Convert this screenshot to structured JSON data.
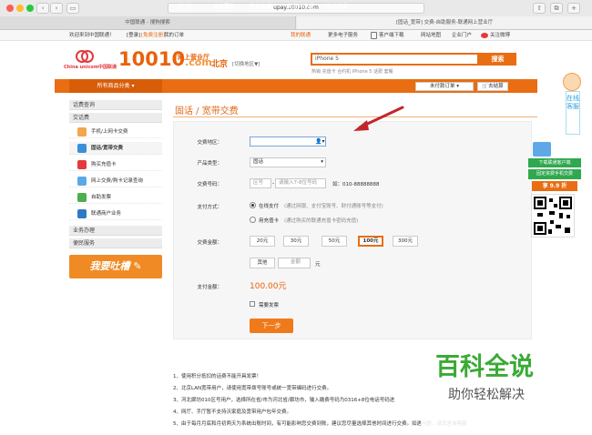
{
  "browser": {
    "url": "upay.10010.com",
    "tabs": [
      "中国联通 - 搜狗搜索",
      "[固话_宽带] 交费-自助服务-联通网上营业厅"
    ]
  },
  "topbar": {
    "welcome": "欢迎来到中国联通！",
    "login": "[登录]",
    "register": "[免费注册]",
    "my_orders": "我的订单",
    "my_unicom": "我的联通",
    "more_ebiz": "更多电子服务",
    "client_download": "客户端下载",
    "site_map": "网站地图",
    "enterprise": "企业门户",
    "weibo": "关注微博"
  },
  "header": {
    "logo_text": "China unicom中国联通",
    "brand": "10010",
    "brand_com": ".com",
    "brand_sub": "网上营业厅",
    "city": "北京",
    "city_switch": "[切换地区▼]",
    "search_value": "iPhone 5",
    "search_button": "搜索",
    "hot_words": "热销 充值卡  合约机  iPhone 5 话费  套餐"
  },
  "nav": {
    "categories": "所有商品分类",
    "items": [
      "首  页",
      "自助服务",
      "积分商城",
      "老用户专区",
      "中小企业"
    ],
    "unpaid_orders": "未付款订单",
    "cart": "去结算"
  },
  "sidebar": {
    "sections": [
      {
        "title": "话费查询",
        "items": []
      },
      {
        "title": "交话费",
        "items": [
          "手机/上网卡交费",
          "固话/宽带交费",
          "购买充值卡",
          "网上交费/购卡记录查询",
          "自助发票",
          "联通商户业务"
        ]
      },
      {
        "title": "业务办理",
        "items": []
      },
      {
        "title": "便民服务",
        "items": []
      }
    ],
    "complaint_banner": "我要吐槽"
  },
  "main": {
    "title": "固话 / 宽带交费",
    "fields": {
      "area_label": "交费地区：",
      "product_label": "产品类型：",
      "product_value": "固话",
      "number_label": "交费号码：",
      "area_code_placeholder": "区号",
      "dash": "-",
      "number_placeholder": "请输入7-8位号码",
      "example": "如：010-88888888",
      "method_label": "支付方式：",
      "method_online": "在线支付",
      "method_online_desc": "(通过网银、支付宝账号、财付通账号等支付)",
      "method_card": "用充值卡",
      "method_card_desc": "(通过购买的联通充值卡密码充值)",
      "amount_label": "交费金额：",
      "amounts": [
        "20元",
        "30元",
        "50元",
        "100元",
        "300元"
      ],
      "amount_selected": "100元",
      "other": "其他",
      "amount_placeholder": "金额",
      "unit": "元",
      "pay_label": "支付金额：",
      "pay_value": "100.00元",
      "invoice": "需要发票",
      "next_button": "下一步"
    },
    "notes": [
      "1、使用积分抵扣的话费不能开具发票！",
      "2、北京LAN宽带用户，请使用宽带拨号账号或统一宽带编码进行交费。",
      "3、河北廊坊010区号用户，选择所在省/市为河北省/廊坊市，输入缴费号码为0316+8位电话号码进",
      "4、网厅、手厅暂不支持沃家庭及宽带用户包年交费。",
      "5、由于每月月底和月初两天为系统出账时间，有可能影响您交费到账，建议您尽量选择其他时间进行交费。如遇问题，请您咨询客服"
    ]
  },
  "right_float": {
    "online_service": "在线客服",
    "download_label": "下载联通客户端",
    "fixed_traffic": "固定资费手机交费",
    "discount": "享 9.9 折"
  },
  "watermark": {
    "title": "百科全说",
    "subtitle": "助你轻松解决"
  },
  "colors": {
    "accent": "#e96d12",
    "title_orange": "#e0691a",
    "price_orange": "#e8620c",
    "nav_dark": "#d85d08"
  }
}
